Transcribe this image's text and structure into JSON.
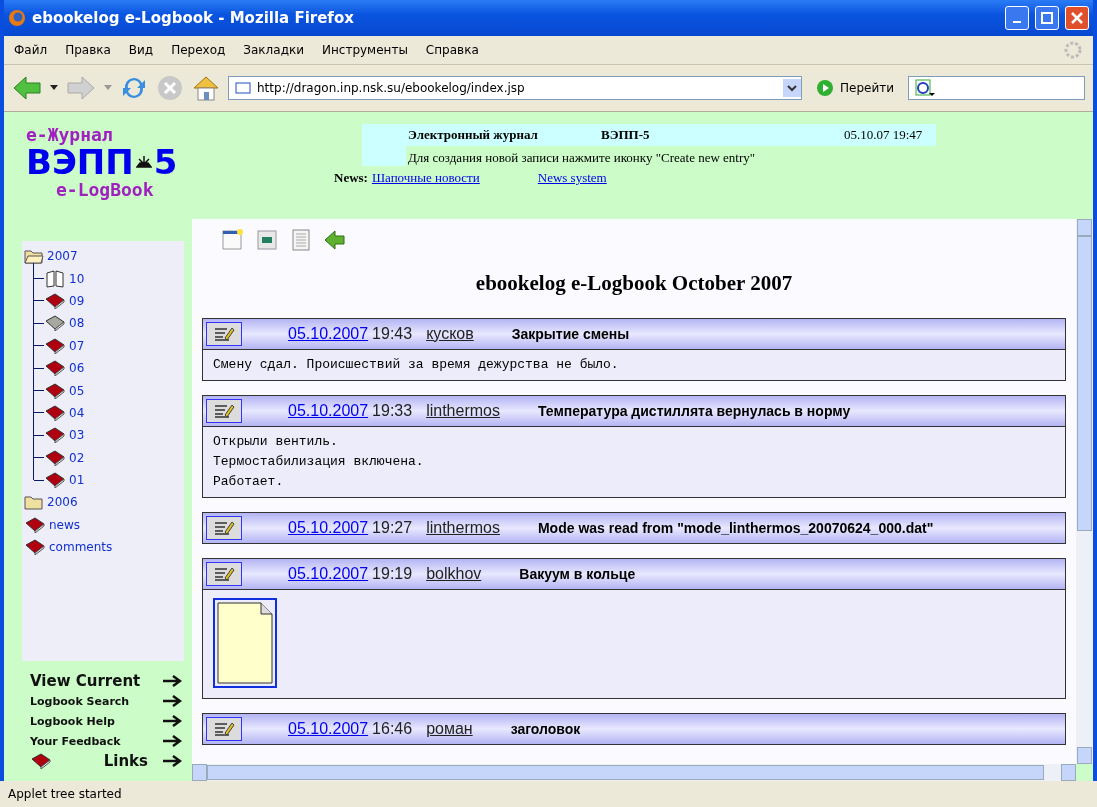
{
  "window": {
    "title": "ebookelog e-Logbook - Mozilla Firefox"
  },
  "menu": [
    {
      "label": "Файл"
    },
    {
      "label": "Правка"
    },
    {
      "label": "Вид"
    },
    {
      "label": "Переход"
    },
    {
      "label": "Закладки"
    },
    {
      "label": "Инструменты"
    },
    {
      "label": "Справка"
    }
  ],
  "toolbar": {
    "address": "http://dragon.inp.nsk.su/ebookelog/index.jsp",
    "go_label": "Перейти"
  },
  "logo": {
    "line_1": "е-Журнал",
    "line_2a": "ВЭПП",
    "line_2b": "5",
    "line_3": "e-LogBook"
  },
  "header": {
    "journal_label": "Электронный журнал",
    "journal_name": "ВЭПП-5",
    "datetime": "05.10.07 19:47",
    "hint": "Для создания новой записи нажмите иконку \"Create new entry\"",
    "news_label": "News:",
    "news_links": [
      "Шапочные новости",
      "News system"
    ]
  },
  "tree": [
    {
      "kind": "folder",
      "label": "2007",
      "expanded": true,
      "children": [
        {
          "kind": "open-book",
          "label": "10"
        },
        {
          "kind": "book",
          "label": "09"
        },
        {
          "kind": "grey-book",
          "label": "08"
        },
        {
          "kind": "book",
          "label": "07"
        },
        {
          "kind": "book",
          "label": "06"
        },
        {
          "kind": "book",
          "label": "05"
        },
        {
          "kind": "book",
          "label": "04"
        },
        {
          "kind": "book",
          "label": "03"
        },
        {
          "kind": "book",
          "label": "02"
        },
        {
          "kind": "book",
          "label": "01"
        }
      ]
    },
    {
      "kind": "folder",
      "label": "2006",
      "expanded": false
    },
    {
      "kind": "book",
      "label": "news"
    },
    {
      "kind": "book",
      "label": "comments"
    }
  ],
  "nav_links": [
    {
      "label": "View Current",
      "kind": "large"
    },
    {
      "label": "Logbook Search",
      "kind": "small"
    },
    {
      "label": "Logbook Help",
      "kind": "small"
    },
    {
      "label": "Your Feedback",
      "kind": "small"
    },
    {
      "label": "Links",
      "kind": "book"
    }
  ],
  "page_title": "ebookelog e-Logbook October 2007",
  "entries": [
    {
      "date": "05.10.2007",
      "time": "19:43",
      "author": "кусков",
      "title": "Закрытие смены",
      "body": [
        "Смену сдал. Происшествий за время дежурства не было."
      ]
    },
    {
      "date": "05.10.2007",
      "time": "19:33",
      "author": "linthermos",
      "title": "Температура дистиллята вернулась в норму",
      "body": [
        "Открыли вентиль.",
        "Термостабилизация включена.",
        "Работает."
      ]
    },
    {
      "date": "05.10.2007",
      "time": "19:27",
      "author": "linthermos",
      "title": "Mode was read from \"mode_linthermos_20070624_000.dat\""
    },
    {
      "date": "05.10.2007",
      "time": "19:19",
      "author": "bolkhov",
      "title": "Вакуум в кольце",
      "attachment": true
    },
    {
      "date": "05.10.2007",
      "time": "16:46",
      "author": "роман",
      "title": "заголовок"
    }
  ],
  "status_bar": "Applet tree started"
}
